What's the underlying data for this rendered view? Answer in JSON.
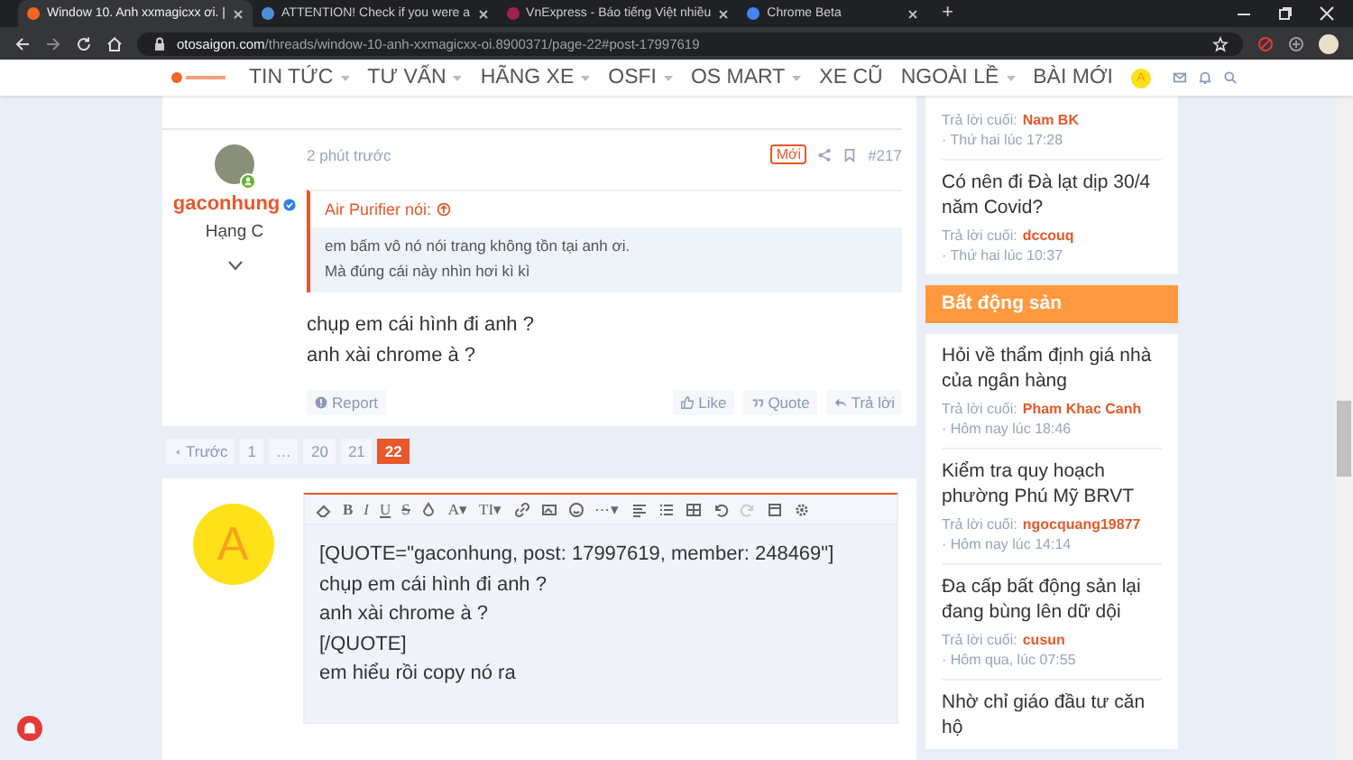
{
  "browser": {
    "tabs": [
      {
        "title": "Window 10. Anh xxmagicxx ơi. |",
        "selected": true
      },
      {
        "title": "ATTENTION! Check if you were a",
        "selected": false
      },
      {
        "title": "VnExpress - Báo tiếng Việt nhiều",
        "selected": false
      },
      {
        "title": "Chrome Beta",
        "selected": false
      }
    ],
    "new_tab": "+",
    "url": {
      "domain": "otosaigon.com",
      "path": "/threads/window-10-anh-xxmagicxx-oi.8900371/page-22#post-17997619"
    }
  },
  "nav": {
    "items": [
      {
        "label": "TIN TỨC",
        "dropdown": true
      },
      {
        "label": "TƯ VẤN",
        "dropdown": true
      },
      {
        "label": "HÃNG XE",
        "dropdown": true
      },
      {
        "label": "OSFI",
        "dropdown": true
      },
      {
        "label": "OS MART",
        "dropdown": true
      },
      {
        "label": "XE CŨ",
        "dropdown": false
      },
      {
        "label": "NGOÀI LỀ",
        "dropdown": true
      },
      {
        "label": "BÀI MỚI",
        "dropdown": false
      }
    ],
    "user_avatar": "A"
  },
  "post": {
    "username": "gaconhung",
    "verified": true,
    "online": true,
    "rank": "Hạng C",
    "time": "2 phút trước",
    "badge": "Mới",
    "number": "#217",
    "quote": {
      "author": "Air Purifier nói:",
      "lines": [
        "em bấm vô nó nói trang không tồn tại anh ơi.",
        "Mà đúng cái này nhìn hơi kì kì"
      ]
    },
    "body": [
      "chụp em cái hình đi anh ?",
      "anh xài chrome à ?"
    ],
    "actions": [
      {
        "label": "Report",
        "kind": "report"
      },
      {
        "label": "Like",
        "kind": "like"
      },
      {
        "label": "Quote",
        "kind": "quote"
      },
      {
        "label": "Trả lời",
        "kind": "reply"
      }
    ]
  },
  "pagination": [
    {
      "label": "Trước",
      "kind": "prev",
      "selected": false
    },
    {
      "label": "1",
      "kind": "page",
      "selected": false
    },
    {
      "label": "…",
      "kind": "gap",
      "selected": false
    },
    {
      "label": "20",
      "kind": "page",
      "selected": false
    },
    {
      "label": "21",
      "kind": "page",
      "selected": false
    },
    {
      "label": "22",
      "kind": "page",
      "selected": true
    }
  ],
  "reply": {
    "avatar": "A",
    "toolbar": [
      {
        "kind": "eraser"
      },
      {
        "kind": "glyph",
        "glyph": "B"
      },
      {
        "kind": "glyph",
        "glyph": "I"
      },
      {
        "kind": "glyph",
        "glyph": "U"
      },
      {
        "kind": "glyph",
        "glyph": "S"
      },
      {
        "kind": "drop"
      },
      {
        "kind": "glyph",
        "glyph": "A▾"
      },
      {
        "kind": "glyph",
        "glyph": "TI▾"
      },
      {
        "kind": "link"
      },
      {
        "kind": "image"
      },
      {
        "kind": "smiley"
      },
      {
        "kind": "glyph",
        "glyph": "⋯▾"
      },
      {
        "kind": "align"
      },
      {
        "kind": "list"
      },
      {
        "kind": "table"
      },
      {
        "kind": "undo"
      },
      {
        "kind": "redo"
      },
      {
        "kind": "template"
      },
      {
        "kind": "gear"
      }
    ],
    "lines": [
      "[QUOTE=\"gaconhung, post: 17997619, member: 248469\"]",
      "chụp em cái hình đi anh ?",
      "anh xài chrome à ?",
      "[/QUOTE]",
      "em hiểu rồi copy nó ra"
    ]
  },
  "sidebar": [
    {
      "kind": "card",
      "topics": [
        {
          "label": "Trả lời cuối:",
          "user": "Nam BK",
          "time": "· Thứ hai lúc 17:28"
        },
        {
          "title": "Có nên đi Đà lạt dịp 30/4 năm Covid?",
          "label": "Trả lời cuối:",
          "user": "dccouq",
          "time": "· Thứ hai lúc 10:37"
        }
      ]
    },
    {
      "kind": "header",
      "title": "Bất động sản"
    },
    {
      "kind": "card",
      "topics": [
        {
          "title": "Hỏi về thẩm định giá nhà của ngân hàng",
          "label": "Trả lời cuối:",
          "user": "Pham Khac Canh",
          "time": "· Hôm nay lúc 18:46"
        },
        {
          "title": "Kiểm tra quy hoạch phường Phú Mỹ BRVT",
          "label": "Trả lời cuối:",
          "user": "ngocquang19877",
          "time": "· Hôm nay lúc 14:14"
        },
        {
          "title": "Đa cấp bất động sản lại đang bùng lên dữ dội",
          "label": "Trả lời cuối:",
          "user": "cusun",
          "time": "· Hôm qua, lúc 07:55"
        },
        {
          "title": "Nhờ chỉ giáo đầu tư căn hộ"
        }
      ]
    }
  ]
}
